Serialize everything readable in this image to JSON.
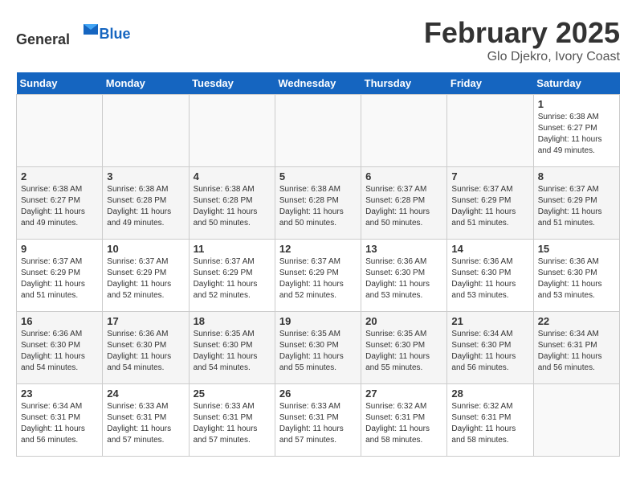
{
  "header": {
    "logo_general": "General",
    "logo_blue": "Blue",
    "title": "February 2025",
    "subtitle": "Glo Djekro, Ivory Coast"
  },
  "days_of_week": [
    "Sunday",
    "Monday",
    "Tuesday",
    "Wednesday",
    "Thursday",
    "Friday",
    "Saturday"
  ],
  "weeks": [
    {
      "days": [
        {
          "number": "",
          "info": "",
          "empty": true
        },
        {
          "number": "",
          "info": "",
          "empty": true
        },
        {
          "number": "",
          "info": "",
          "empty": true
        },
        {
          "number": "",
          "info": "",
          "empty": true
        },
        {
          "number": "",
          "info": "",
          "empty": true
        },
        {
          "number": "",
          "info": "",
          "empty": true
        },
        {
          "number": "1",
          "info": "Sunrise: 6:38 AM\nSunset: 6:27 PM\nDaylight: 11 hours\nand 49 minutes."
        }
      ]
    },
    {
      "days": [
        {
          "number": "2",
          "info": "Sunrise: 6:38 AM\nSunset: 6:27 PM\nDaylight: 11 hours\nand 49 minutes."
        },
        {
          "number": "3",
          "info": "Sunrise: 6:38 AM\nSunset: 6:28 PM\nDaylight: 11 hours\nand 49 minutes."
        },
        {
          "number": "4",
          "info": "Sunrise: 6:38 AM\nSunset: 6:28 PM\nDaylight: 11 hours\nand 50 minutes."
        },
        {
          "number": "5",
          "info": "Sunrise: 6:38 AM\nSunset: 6:28 PM\nDaylight: 11 hours\nand 50 minutes."
        },
        {
          "number": "6",
          "info": "Sunrise: 6:37 AM\nSunset: 6:28 PM\nDaylight: 11 hours\nand 50 minutes."
        },
        {
          "number": "7",
          "info": "Sunrise: 6:37 AM\nSunset: 6:29 PM\nDaylight: 11 hours\nand 51 minutes."
        },
        {
          "number": "8",
          "info": "Sunrise: 6:37 AM\nSunset: 6:29 PM\nDaylight: 11 hours\nand 51 minutes."
        }
      ]
    },
    {
      "days": [
        {
          "number": "9",
          "info": "Sunrise: 6:37 AM\nSunset: 6:29 PM\nDaylight: 11 hours\nand 51 minutes."
        },
        {
          "number": "10",
          "info": "Sunrise: 6:37 AM\nSunset: 6:29 PM\nDaylight: 11 hours\nand 52 minutes."
        },
        {
          "number": "11",
          "info": "Sunrise: 6:37 AM\nSunset: 6:29 PM\nDaylight: 11 hours\nand 52 minutes."
        },
        {
          "number": "12",
          "info": "Sunrise: 6:37 AM\nSunset: 6:29 PM\nDaylight: 11 hours\nand 52 minutes."
        },
        {
          "number": "13",
          "info": "Sunrise: 6:36 AM\nSunset: 6:30 PM\nDaylight: 11 hours\nand 53 minutes."
        },
        {
          "number": "14",
          "info": "Sunrise: 6:36 AM\nSunset: 6:30 PM\nDaylight: 11 hours\nand 53 minutes."
        },
        {
          "number": "15",
          "info": "Sunrise: 6:36 AM\nSunset: 6:30 PM\nDaylight: 11 hours\nand 53 minutes."
        }
      ]
    },
    {
      "days": [
        {
          "number": "16",
          "info": "Sunrise: 6:36 AM\nSunset: 6:30 PM\nDaylight: 11 hours\nand 54 minutes."
        },
        {
          "number": "17",
          "info": "Sunrise: 6:36 AM\nSunset: 6:30 PM\nDaylight: 11 hours\nand 54 minutes."
        },
        {
          "number": "18",
          "info": "Sunrise: 6:35 AM\nSunset: 6:30 PM\nDaylight: 11 hours\nand 54 minutes."
        },
        {
          "number": "19",
          "info": "Sunrise: 6:35 AM\nSunset: 6:30 PM\nDaylight: 11 hours\nand 55 minutes."
        },
        {
          "number": "20",
          "info": "Sunrise: 6:35 AM\nSunset: 6:30 PM\nDaylight: 11 hours\nand 55 minutes."
        },
        {
          "number": "21",
          "info": "Sunrise: 6:34 AM\nSunset: 6:30 PM\nDaylight: 11 hours\nand 56 minutes."
        },
        {
          "number": "22",
          "info": "Sunrise: 6:34 AM\nSunset: 6:31 PM\nDaylight: 11 hours\nand 56 minutes."
        }
      ]
    },
    {
      "days": [
        {
          "number": "23",
          "info": "Sunrise: 6:34 AM\nSunset: 6:31 PM\nDaylight: 11 hours\nand 56 minutes."
        },
        {
          "number": "24",
          "info": "Sunrise: 6:33 AM\nSunset: 6:31 PM\nDaylight: 11 hours\nand 57 minutes."
        },
        {
          "number": "25",
          "info": "Sunrise: 6:33 AM\nSunset: 6:31 PM\nDaylight: 11 hours\nand 57 minutes."
        },
        {
          "number": "26",
          "info": "Sunrise: 6:33 AM\nSunset: 6:31 PM\nDaylight: 11 hours\nand 57 minutes."
        },
        {
          "number": "27",
          "info": "Sunrise: 6:32 AM\nSunset: 6:31 PM\nDaylight: 11 hours\nand 58 minutes."
        },
        {
          "number": "28",
          "info": "Sunrise: 6:32 AM\nSunset: 6:31 PM\nDaylight: 11 hours\nand 58 minutes."
        },
        {
          "number": "",
          "info": "",
          "empty": true
        }
      ]
    }
  ]
}
